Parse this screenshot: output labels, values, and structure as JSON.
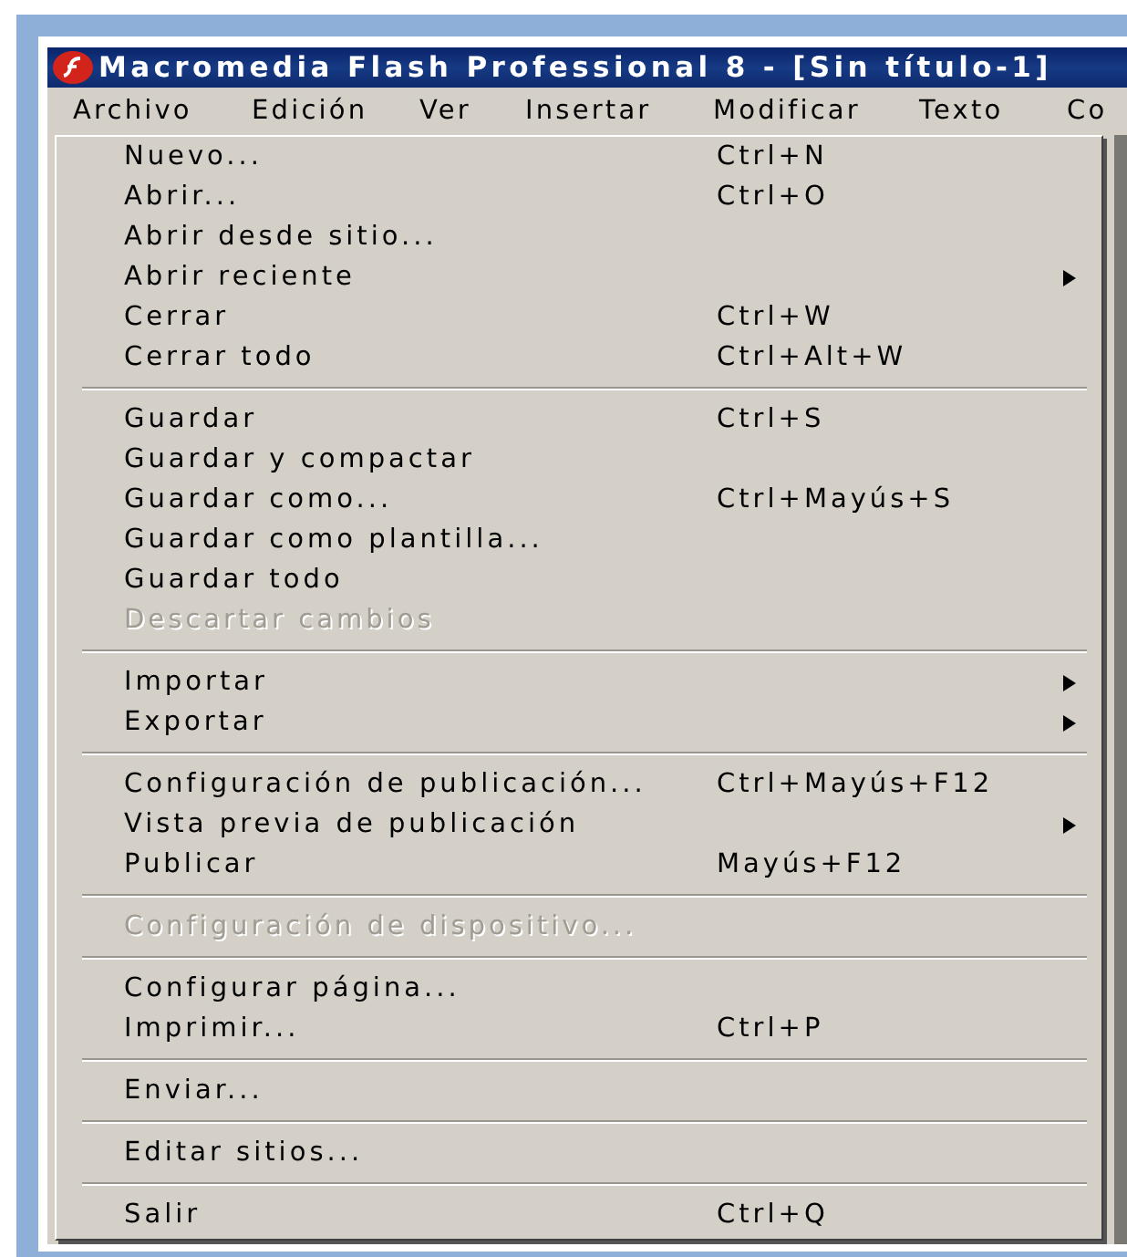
{
  "window": {
    "title": "Macromedia Flash Professional 8 - [Sin título-1]"
  },
  "menubar": [
    {
      "label": "Archivo",
      "selected": true
    },
    {
      "label": "Edición",
      "selected": false
    },
    {
      "label": "Ver",
      "selected": false
    },
    {
      "label": "Insertar",
      "selected": false
    },
    {
      "label": "Modificar",
      "selected": false
    },
    {
      "label": "Texto",
      "selected": false
    },
    {
      "label": "Co",
      "selected": false
    }
  ],
  "menu": [
    {
      "kind": "item",
      "label": "Nuevo...",
      "shortcut": "Ctrl+N",
      "submenu": false,
      "disabled": false
    },
    {
      "kind": "item",
      "label": "Abrir...",
      "shortcut": "Ctrl+O",
      "submenu": false,
      "disabled": false
    },
    {
      "kind": "item",
      "label": "Abrir desde sitio...",
      "submenu": false,
      "disabled": false
    },
    {
      "kind": "item",
      "label": "Abrir reciente",
      "submenu": true,
      "disabled": false
    },
    {
      "kind": "item",
      "label": "Cerrar",
      "shortcut": "Ctrl+W",
      "submenu": false,
      "disabled": false
    },
    {
      "kind": "item",
      "label": "Cerrar todo",
      "shortcut": "Ctrl+Alt+W",
      "submenu": false,
      "disabled": false
    },
    {
      "kind": "separator"
    },
    {
      "kind": "item",
      "label": "Guardar",
      "shortcut": "Ctrl+S",
      "submenu": false,
      "disabled": false
    },
    {
      "kind": "item",
      "label": "Guardar y compactar",
      "submenu": false,
      "disabled": false
    },
    {
      "kind": "item",
      "label": "Guardar como...",
      "shortcut": "Ctrl+Mayús+S",
      "submenu": false,
      "disabled": false
    },
    {
      "kind": "item",
      "label": "Guardar como plantilla...",
      "submenu": false,
      "disabled": false
    },
    {
      "kind": "item",
      "label": "Guardar todo",
      "submenu": false,
      "disabled": false
    },
    {
      "kind": "item",
      "label": "Descartar cambios",
      "submenu": false,
      "disabled": true
    },
    {
      "kind": "separator"
    },
    {
      "kind": "item",
      "label": "Importar",
      "submenu": true,
      "disabled": false
    },
    {
      "kind": "item",
      "label": "Exportar",
      "submenu": true,
      "disabled": false
    },
    {
      "kind": "separator"
    },
    {
      "kind": "item",
      "label": "Configuración de publicación...",
      "shortcut": "Ctrl+Mayús+F12",
      "submenu": false,
      "disabled": false
    },
    {
      "kind": "item",
      "label": "Vista previa de publicación",
      "submenu": true,
      "disabled": false
    },
    {
      "kind": "item",
      "label": "Publicar",
      "shortcut": "Mayús+F12",
      "submenu": false,
      "disabled": false
    },
    {
      "kind": "separator"
    },
    {
      "kind": "item",
      "label": "Configuración de dispositivo...",
      "submenu": false,
      "disabled": true
    },
    {
      "kind": "separator"
    },
    {
      "kind": "item",
      "label": "Configurar página...",
      "submenu": false,
      "disabled": false
    },
    {
      "kind": "item",
      "label": "Imprimir...",
      "shortcut": "Ctrl+P",
      "submenu": false,
      "disabled": false
    },
    {
      "kind": "separator"
    },
    {
      "kind": "item",
      "label": "Enviar...",
      "submenu": false,
      "disabled": false
    },
    {
      "kind": "separator"
    },
    {
      "kind": "item",
      "label": "Editar sitios...",
      "submenu": false,
      "disabled": false
    },
    {
      "kind": "separator"
    },
    {
      "kind": "item",
      "label": "Salir",
      "shortcut": "Ctrl+Q",
      "submenu": false,
      "disabled": false
    }
  ]
}
